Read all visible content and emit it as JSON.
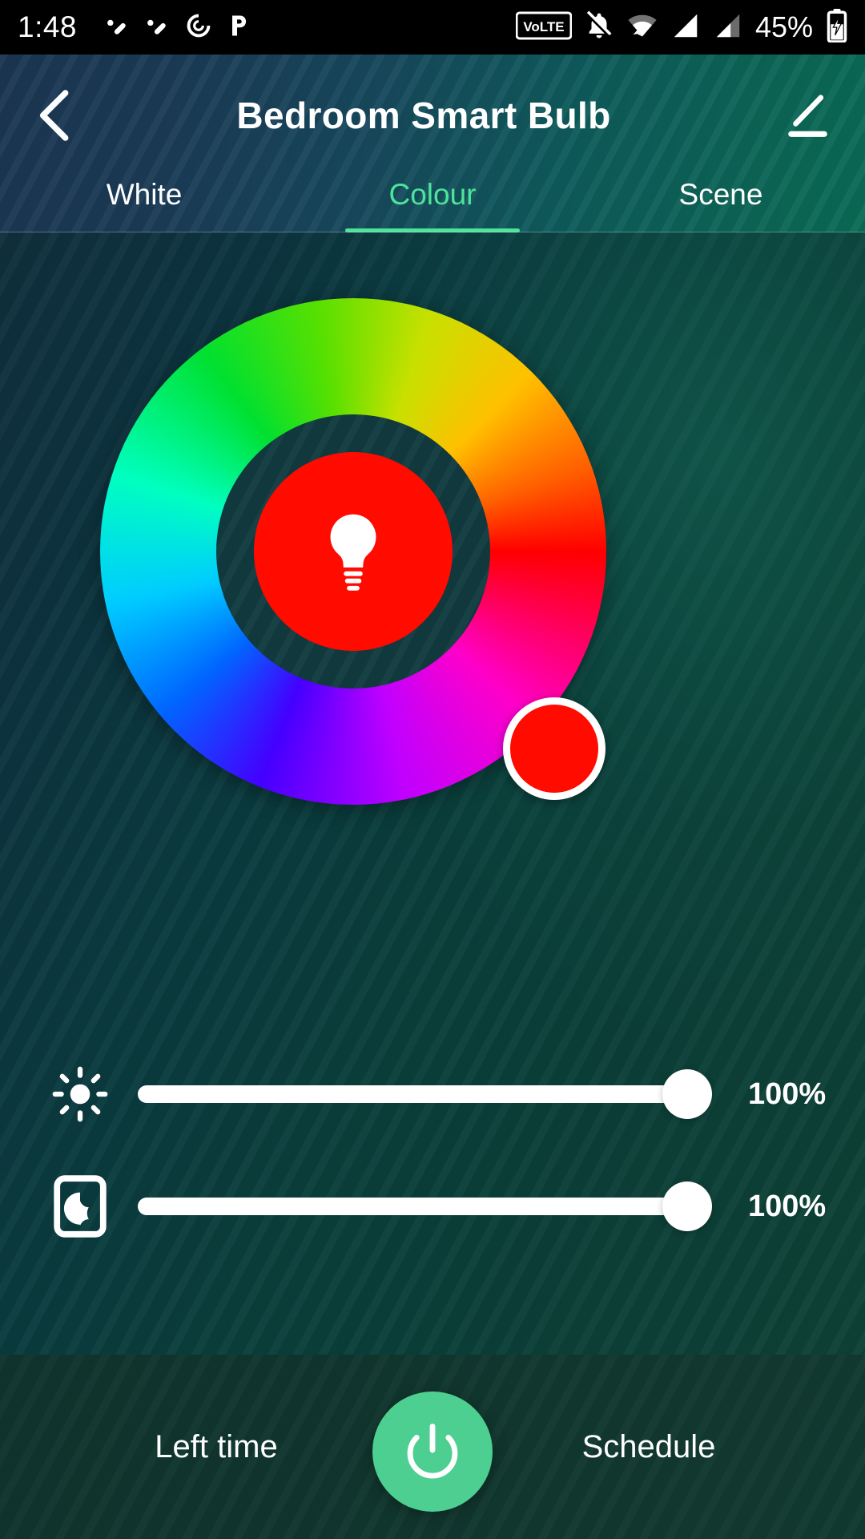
{
  "statusbar": {
    "time": "1:48",
    "battery_percent": "45%",
    "icons": [
      {
        "name": "app-notification-icon-1",
        "glyph": "check-slash"
      },
      {
        "name": "app-notification-icon-2",
        "glyph": "check-slash"
      },
      {
        "name": "pocketcasts-icon",
        "glyph": "spiral"
      },
      {
        "name": "pandora-icon",
        "glyph": "p"
      },
      {
        "name": "volte-icon",
        "glyph": "VoLTE"
      },
      {
        "name": "silent-bell-icon",
        "glyph": "bell-off"
      },
      {
        "name": "wifi-icon",
        "glyph": "wifi"
      },
      {
        "name": "signal-sim1-icon",
        "glyph": "signal-full"
      },
      {
        "name": "signal-sim2-icon",
        "glyph": "signal-partial"
      },
      {
        "name": "battery-charging-icon",
        "glyph": "battery-bolt"
      }
    ],
    "volte_label": "VoLTE"
  },
  "header": {
    "title": "Bedroom Smart Bulb",
    "back_label": "Back",
    "edit_label": "Edit"
  },
  "tabs": [
    {
      "label": "White",
      "active": false
    },
    {
      "label": "Colour",
      "active": true
    },
    {
      "label": "Scene",
      "active": false
    }
  ],
  "colour_wheel": {
    "selected_color": "#ff0b00",
    "knob_color": "#ff0b00",
    "knob_border_color": "#ffffff",
    "center_icon": "bulb-icon",
    "ring_gap_color": "#123c40",
    "hue_stops": [
      "#ff0000",
      "#ff00c8",
      "#c000ff",
      "#4400ff",
      "#0066ff",
      "#00ccff",
      "#00ffc0",
      "#00e030",
      "#58e000",
      "#c8e000",
      "#ffc000",
      "#ff6000",
      "#ff0000"
    ]
  },
  "sliders": [
    {
      "name": "brightness",
      "icon": "sun-icon",
      "value": 100,
      "value_label": "100%"
    },
    {
      "name": "saturation",
      "icon": "contrast-icon",
      "value": 100,
      "value_label": "100%"
    }
  ],
  "bottombar": {
    "left_action": "Left time",
    "right_action": "Schedule",
    "power_label": "Power",
    "power_color": "#4ecf92"
  },
  "theme": {
    "accent_green": "#4ee39a",
    "header_start": "#1b3652",
    "header_end": "#0a6b55",
    "body_start": "#102f3d",
    "body_end": "#0f4236"
  }
}
